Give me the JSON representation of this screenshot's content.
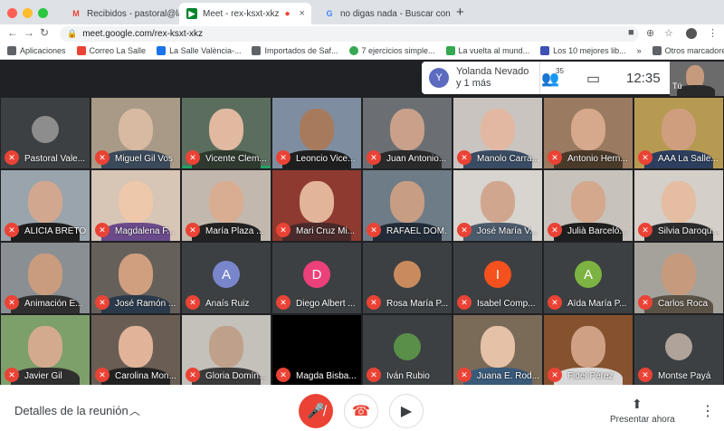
{
  "browser": {
    "tabs": [
      {
        "label": "Recibidos - pastoral@lasallevp",
        "favicon": "gmail-icon",
        "active": false
      },
      {
        "label": "Meet - rex-ksxt-xkz",
        "favicon": "meet-icon",
        "active": true
      },
      {
        "label": "no digas nada - Buscar con Go",
        "favicon": "google-icon",
        "active": false
      }
    ],
    "new_tab": "+",
    "url": "meet.google.com/rex-ksxt-xkz",
    "bookmarks": [
      {
        "label": "Aplicaciones",
        "color": "#5f6368"
      },
      {
        "label": "Correo La Salle",
        "color": "#ea4335"
      },
      {
        "label": "La Salle València-...",
        "color": "#1a73e8"
      },
      {
        "label": "Importados de Saf...",
        "color": "#5f6368"
      },
      {
        "label": "7 ejercicios simple...",
        "color": "#34a853"
      },
      {
        "label": "La vuelta al mund...",
        "color": "#34a853"
      },
      {
        "label": "Los 10 mejores lib...",
        "color": "#3f51b5"
      }
    ],
    "bookmarks_more": "»",
    "other_bookmarks": "Otros marcadores"
  },
  "meet": {
    "presenter_initial": "Y",
    "presenter_line1": "Yolanda Nevado",
    "presenter_line2": "y 1 más",
    "participant_count": "35",
    "clock": "12:35",
    "self_label": "Tú",
    "participants": [
      {
        "name": "Pastoral Vale...",
        "type": "photoavatar",
        "color": "#8d8d8d"
      },
      {
        "name": "Miguel Gil Vos",
        "type": "video",
        "bg": "#a89a86",
        "skin": "#d8b9a2",
        "shirt": "#3b4a5a"
      },
      {
        "name": "Vicente Clem...",
        "type": "video",
        "bg": "#5b6e5e",
        "skin": "#e0b9a0",
        "shirt": "#2f3a2f",
        "speaking": true
      },
      {
        "name": "Leoncio Vice...",
        "type": "video",
        "bg": "#7e8ea0",
        "skin": "#a87a5c",
        "shirt": "#1e1e1e"
      },
      {
        "name": "Juan Antonio...",
        "type": "video",
        "bg": "#6b6f73",
        "skin": "#c9a08a",
        "shirt": "#2a2a2a"
      },
      {
        "name": "Manolo Carra...",
        "type": "video",
        "bg": "#c9c4bf",
        "skin": "#e2b8a2",
        "shirt": "#3a4c64"
      },
      {
        "name": "Antonio Hern...",
        "type": "video",
        "bg": "#9a7a60",
        "skin": "#d6a98c",
        "shirt": "#4a3a2a"
      },
      {
        "name": "AAA La Salle...",
        "type": "video",
        "bg": "#b79a52",
        "skin": "#cf9e7f",
        "shirt": "#2d3e5e"
      },
      {
        "name": "ALICIA BRETO",
        "type": "video",
        "bg": "#9aa4ac",
        "skin": "#d1a88f",
        "shirt": "#1e1e1e"
      },
      {
        "name": "Magdalena F...",
        "type": "video",
        "bg": "#d7c5b6",
        "skin": "#edc8ab",
        "shirt": "#6a4a8a"
      },
      {
        "name": "María Plaza ...",
        "type": "video",
        "bg": "#c2b8ae",
        "skin": "#d9ad92",
        "shirt": "#222222"
      },
      {
        "name": "Mari Cruz Mi...",
        "type": "video",
        "bg": "#8f3a30",
        "skin": "#e2b49a",
        "shirt": "#4a2a2a"
      },
      {
        "name": "RAFAEL DOM...",
        "type": "video",
        "bg": "#6e7c88",
        "skin": "#c79d84",
        "shirt": "#222c38"
      },
      {
        "name": "José María V...",
        "type": "video",
        "bg": "#d8d4cf",
        "skin": "#d0a78e",
        "shirt": "#4c5b6c"
      },
      {
        "name": "Julià Barceló...",
        "type": "video",
        "bg": "#c7c2bc",
        "skin": "#d3a88c",
        "shirt": "#1e1e1e"
      },
      {
        "name": "Silvia Daroqu...",
        "type": "video",
        "bg": "#d4cfc8",
        "skin": "#e5bda2",
        "shirt": "#2c2c2c"
      },
      {
        "name": "Animación E...",
        "type": "video",
        "bg": "#8a8f93",
        "skin": "#c99c7e",
        "shirt": "#2f2f2f"
      },
      {
        "name": "José Ramón ...",
        "type": "video",
        "bg": "#66605a",
        "skin": "#cf9f80",
        "shirt": "#2a3a4a"
      },
      {
        "name": "Anaís Ruiz",
        "type": "avatar",
        "initial": "A",
        "color": "#7986cb"
      },
      {
        "name": "Diego Albert ...",
        "type": "avatar",
        "initial": "D",
        "color": "#ec407a"
      },
      {
        "name": "Rosa María P...",
        "type": "photoavatar",
        "color": "#c98b5e"
      },
      {
        "name": "Isabel Comp...",
        "type": "avatar",
        "initial": "I",
        "color": "#f4511e"
      },
      {
        "name": "Aïda María P...",
        "type": "avatar",
        "initial": "A",
        "color": "#7cb342"
      },
      {
        "name": "Carlos Roca",
        "type": "video",
        "bg": "#a5a29c",
        "skin": "#c69a7d",
        "shirt": "#5b5246"
      },
      {
        "name": "Javier Gil",
        "type": "video",
        "bg": "#7da06a",
        "skin": "#d4aa8f",
        "shirt": "#2f2f2f"
      },
      {
        "name": "Carolina Mon...",
        "type": "video",
        "bg": "#6a5e54",
        "skin": "#e1b49a",
        "shirt": "#222222"
      },
      {
        "name": "Gloria Domín...",
        "type": "video",
        "bg": "#c4c0ba",
        "skin": "#bfa08a",
        "shirt": "#3a3a3a"
      },
      {
        "name": "Magda Bisba...",
        "type": "blank"
      },
      {
        "name": "Iván Rubio",
        "type": "photoavatar",
        "color": "#5a8f4a"
      },
      {
        "name": "Juana E. Rod...",
        "type": "video",
        "bg": "#7a6a58",
        "skin": "#e5c1a8",
        "shirt": "#3a5a7a"
      },
      {
        "name": "Fidel Pérez",
        "type": "video",
        "bg": "#85512e",
        "skin": "#cfa084",
        "shirt": "#d8d8d8"
      },
      {
        "name": "Montse Payá",
        "type": "photoavatar",
        "color": "#b0a49a"
      }
    ],
    "bottom": {
      "details": "Detalles de la reunión",
      "present_label": "Presentar ahora"
    },
    "colors": {
      "accent_red": "#ea4335",
      "meet_bg": "#202124"
    }
  }
}
